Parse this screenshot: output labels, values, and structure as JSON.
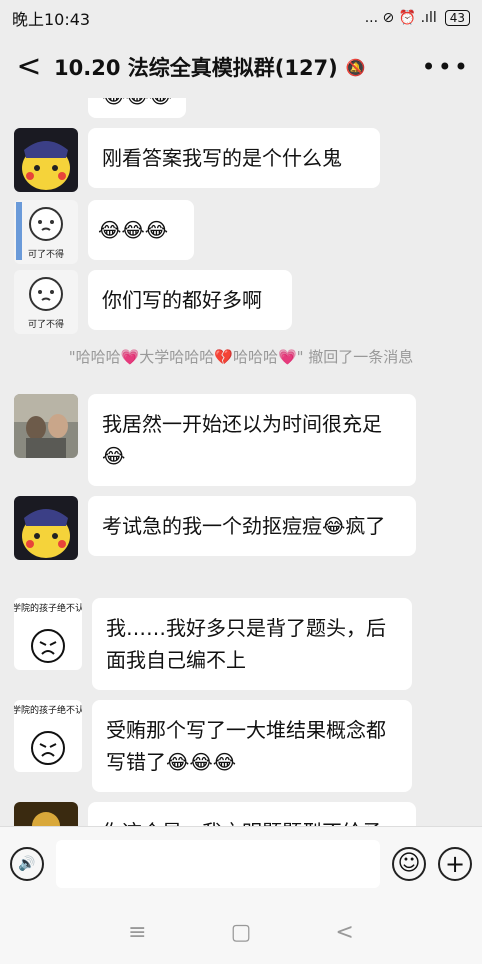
{
  "status": {
    "time": "晚上10:43",
    "icons": "... ⊘ ⏰ .ıll ",
    "battery": "43"
  },
  "header": {
    "back_glyph": "<",
    "title": "10.20 法综全真模拟群(127)",
    "mute_glyph": "🔕",
    "more_glyph": "•••"
  },
  "chat": {
    "top_partial": "😂😂😂",
    "messages": [
      {
        "text": "刚看答案我写的是个什么鬼"
      },
      {
        "text": "😂😂😂"
      },
      {
        "text": "你们写的都好多啊"
      },
      {
        "text": "我居然一开始还以为时间很充足😂"
      },
      {
        "text": "考试急的我一个劲抠痘痘😂疯了"
      },
      {
        "text": "我……我好多只是背了题头，后面我自己编不上"
      },
      {
        "text": "受贿那个写了一大堆结果概念都写错了😂😂😂"
      },
      {
        "text": "你这个是…我之明题题型不给予"
      }
    ],
    "system_notice": "\"哈哈哈💗大学哈哈哈💔哈哈哈💗\" 撤回了一条消息",
    "sticker_text_1": "可了不得",
    "sticker_text_2": "可了不得",
    "sticker_text_3": "法学院的孩子绝不认输",
    "sticker_text_4": "法学院的孩子绝不认输"
  },
  "inputbar": {
    "voice_glyph": "🔊",
    "emoji_glyph": "☺",
    "plus_glyph": "+"
  },
  "navbar": {
    "menu_glyph": "≡",
    "home_glyph": "▢",
    "back_glyph": "<"
  }
}
